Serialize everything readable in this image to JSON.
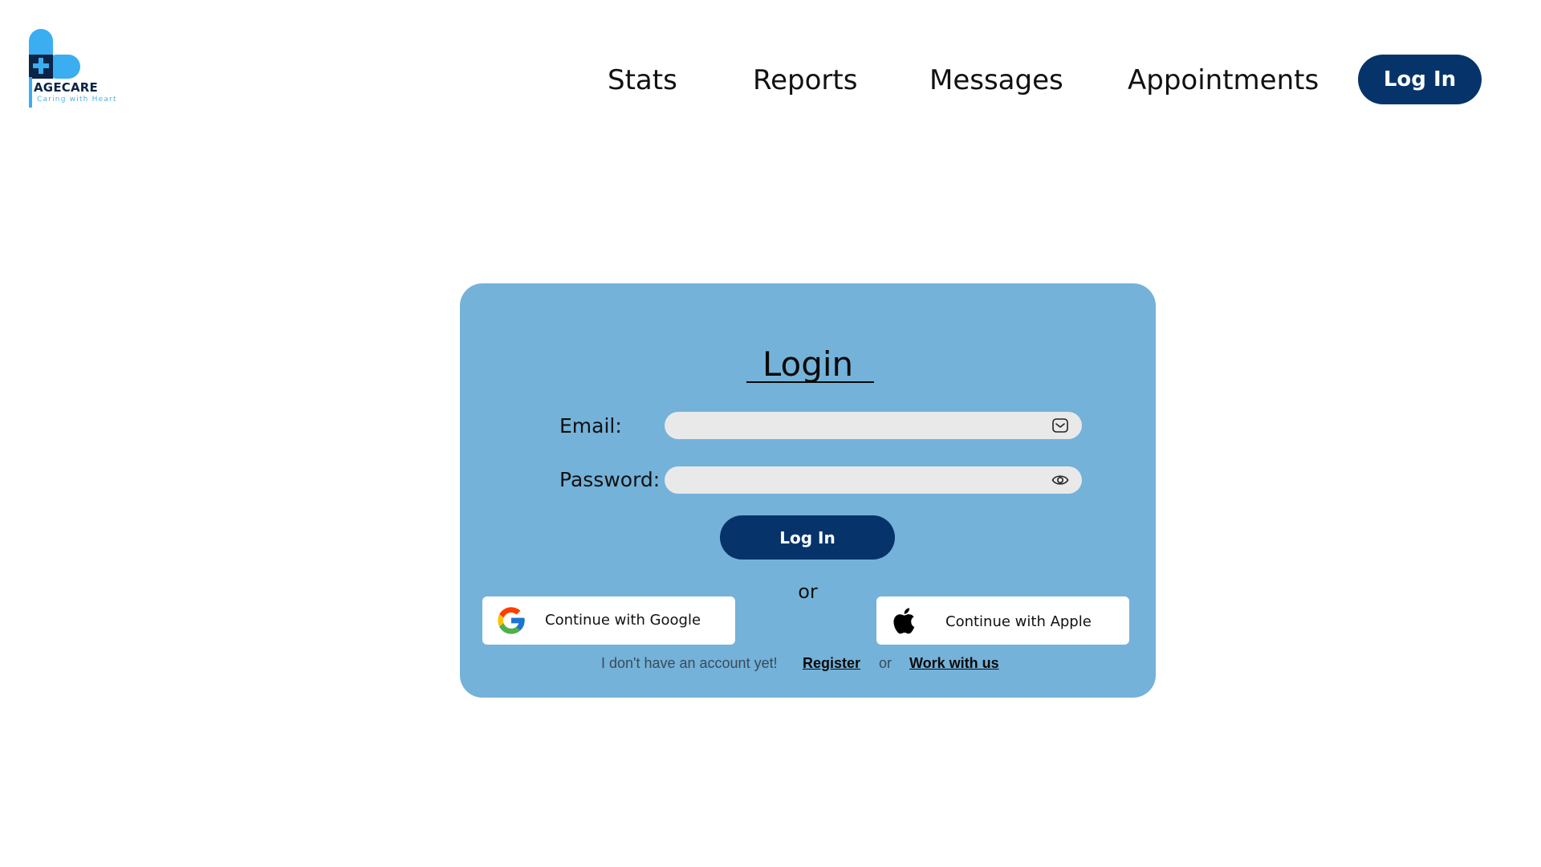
{
  "brand": {
    "name": "AGECARE",
    "tagline": "Caring with Heart",
    "primary_color": "#06346a",
    "accent_color": "#4fb3ec"
  },
  "nav": {
    "items": [
      "Stats",
      "Reports",
      "Messages",
      "Appointments"
    ],
    "login_label": "Log In"
  },
  "login_card": {
    "background": "#74b2d9",
    "title": "Login",
    "email_label": "Email:",
    "email_value": "",
    "email_icon": "mail-icon",
    "password_label": "Password:",
    "password_value": "",
    "password_icon": "eye-icon",
    "submit_label": "Log In",
    "or_text": "or",
    "google_label": "Continue with Google",
    "apple_label": "Continue with Apple",
    "no_account_text": "I don't have an account yet!",
    "register_label": "Register",
    "or_small": "or",
    "work_label": "Work with us"
  }
}
